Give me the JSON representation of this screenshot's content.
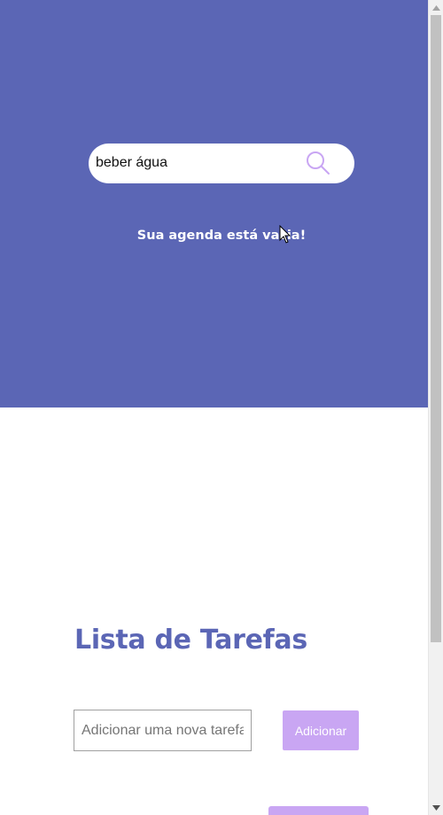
{
  "hero": {
    "search": {
      "value": "beber água",
      "icon": "search-icon",
      "icon_color": "#c9a6f3"
    },
    "empty_message": "Sua agenda está vazia!",
    "background": "#5b66b5"
  },
  "todo": {
    "title": "Lista de Tarefas",
    "input_placeholder": "Adicionar uma nova tarefa",
    "add_label": "Adicionar",
    "button_color": "#c9a6f3",
    "title_color": "#5b66b5"
  },
  "scrollbar": {
    "up_icon": "chevron-up-icon",
    "down_icon": "chevron-down-icon"
  }
}
